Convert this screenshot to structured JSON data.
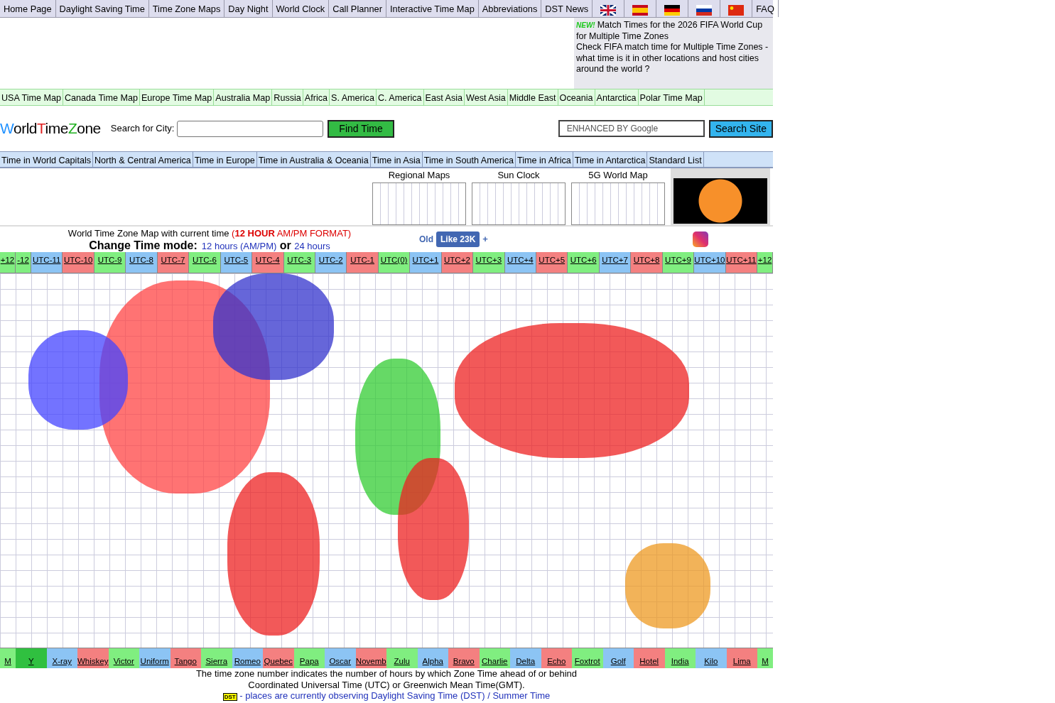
{
  "top_nav": [
    "Home Page",
    "Daylight Saving Time",
    "Time Zone Maps",
    "Day Night",
    "World Clock",
    "Call Planner",
    "Interactive Time Map",
    "Abbreviations",
    "DST News"
  ],
  "faq": "FAQ",
  "news": {
    "badge": "NEW!",
    "title": "Match Times for the 2026 FIFA World Cup for Multiple Time Zones",
    "body": "Check FIFA match time for Multiple Time Zones - what time is it in other locations and host cities around the world ?"
  },
  "region_nav": [
    "USA Time Map",
    "Canada Time Map",
    "Europe Time Map",
    "Australia Map",
    "Russia",
    "Africa",
    "S. America",
    "C. America",
    "East Asia",
    "West Asia",
    "Middle East",
    "Oceania",
    "Antarctica",
    "Polar Time Map"
  ],
  "logo": [
    {
      "text": "W",
      "color": "#1e90ff"
    },
    {
      "text": "orld",
      "color": "#000000"
    },
    {
      "text": "T",
      "color": "#e02020"
    },
    {
      "text": "ime",
      "color": "#000000"
    },
    {
      "text": "Z",
      "color": "#20b020"
    },
    {
      "text": "one",
      "color": "#000000"
    }
  ],
  "city_search": {
    "label": "Search for City:",
    "button": "Find Time"
  },
  "site_search": {
    "placeholder": "ENHANCED BY Google",
    "button": "Search Site"
  },
  "time_nav": [
    "Time in World Capitals",
    "North & Central America",
    "Time in Europe",
    "Time in Australia & Oceania",
    "Time in Asia",
    "Time in South America",
    "Time in Africa",
    "Time in Antarctica",
    "Standard List"
  ],
  "thumbnails": [
    {
      "caption": "Regional Maps"
    },
    {
      "caption": "Sun Clock"
    },
    {
      "caption": "5G World Map"
    }
  ],
  "heading": {
    "title": "World Time Zone Map with current time",
    "format": "(**12 HOUR** AM/PM FORMAT)",
    "mode_label": "Change Time mode:",
    "option_12": "12 hours (AM/PM)",
    "or": "or",
    "option_24": "24 hours"
  },
  "social": {
    "old": "Old",
    "like": "Like 23K",
    "plus": "+"
  },
  "utc_zones": [
    {
      "label": "+12",
      "color": "#80ee80"
    },
    {
      "label": "-12",
      "color": "#80ee80"
    },
    {
      "label": "UTC-11",
      "color": "#8cc4f4"
    },
    {
      "label": "UTC-10",
      "color": "#f48080"
    },
    {
      "label": "UTC-9",
      "color": "#80ee80"
    },
    {
      "label": "UTC-8",
      "color": "#8cc4f4"
    },
    {
      "label": "UTC-7",
      "color": "#f48080"
    },
    {
      "label": "UTC-6",
      "color": "#80ee80"
    },
    {
      "label": "UTC-5",
      "color": "#8cc4f4"
    },
    {
      "label": "UTC-4",
      "color": "#f48080"
    },
    {
      "label": "UTC-3",
      "color": "#80ee80"
    },
    {
      "label": "UTC-2",
      "color": "#8cc4f4"
    },
    {
      "label": "UTC-1",
      "color": "#f48080"
    },
    {
      "label": "UTC(0)",
      "color": "#80ee80"
    },
    {
      "label": "UTC+1",
      "color": "#8cc4f4"
    },
    {
      "label": "UTC+2",
      "color": "#f48080"
    },
    {
      "label": "UTC+3",
      "color": "#80ee80"
    },
    {
      "label": "UTC+4",
      "color": "#8cc4f4"
    },
    {
      "label": "UTC+5",
      "color": "#f48080"
    },
    {
      "label": "UTC+6",
      "color": "#80ee80"
    },
    {
      "label": "UTC+7",
      "color": "#8cc4f4"
    },
    {
      "label": "UTC+8",
      "color": "#f48080"
    },
    {
      "label": "UTC+9",
      "color": "#80ee80"
    },
    {
      "label": "UTC+10",
      "color": "#8cc4f4"
    },
    {
      "label": "UTC+11",
      "color": "#f48080"
    },
    {
      "label": "+12",
      "color": "#80ee80"
    }
  ],
  "military_zones": [
    {
      "label": "M",
      "color": "#80ee80"
    },
    {
      "label": "Y",
      "color": "#30c040"
    },
    {
      "label": "X-ray",
      "color": "#8cc4f4"
    },
    {
      "label": "Whiskey",
      "color": "#f48080"
    },
    {
      "label": "Victor",
      "color": "#80ee80"
    },
    {
      "label": "Uniform",
      "color": "#8cc4f4"
    },
    {
      "label": "Tango",
      "color": "#f48080"
    },
    {
      "label": "Sierra",
      "color": "#80ee80"
    },
    {
      "label": "Romeo",
      "color": "#8cc4f4"
    },
    {
      "label": "Quebec",
      "color": "#f48080"
    },
    {
      "label": "Papa",
      "color": "#80ee80"
    },
    {
      "label": "Oscar",
      "color": "#8cc4f4"
    },
    {
      "label": "Novemb",
      "color": "#f48080"
    },
    {
      "label": "Zulu",
      "color": "#80ee80"
    },
    {
      "label": "Alpha",
      "color": "#8cc4f4"
    },
    {
      "label": "Bravo",
      "color": "#f48080"
    },
    {
      "label": "Charlie",
      "color": "#80ee80"
    },
    {
      "label": "Delta",
      "color": "#8cc4f4"
    },
    {
      "label": "Echo",
      "color": "#f48080"
    },
    {
      "label": "Foxtrot",
      "color": "#80ee80"
    },
    {
      "label": "Golf",
      "color": "#8cc4f4"
    },
    {
      "label": "Hotel",
      "color": "#f48080"
    },
    {
      "label": "India",
      "color": "#80ee80"
    },
    {
      "label": "Kilo",
      "color": "#8cc4f4"
    },
    {
      "label": "Lima",
      "color": "#f48080"
    },
    {
      "label": "M",
      "color": "#80ee80"
    }
  ],
  "footer": {
    "note": "The time zone number indicates the number of hours by which Zone Time ahead of or behind Coordinated Universal Time (UTC) or Greenwich Mean Time(GMT).",
    "dst_badge": "DST",
    "dst_text": "- places are currently observing Daylight Saving Time (DST) / Summer Time"
  }
}
